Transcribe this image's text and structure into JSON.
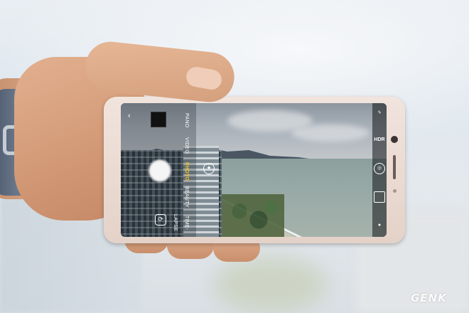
{
  "camera_ui": {
    "back_icon": "chevron-left-icon",
    "modes": [
      "PANO",
      "VIDEO",
      "PHOTO",
      "BEAUTY",
      "TIME-LAPSE"
    ],
    "active_mode": "PHOTO",
    "right_bar": {
      "hdr_label": "HDR",
      "icons": [
        "flash-icon",
        "hdr-icon",
        "filter-icon",
        "grid-icon",
        "dot-icon"
      ]
    },
    "left_bar_icons": [
      "gallery-thumbnail",
      "shutter-button",
      "switch-camera-icon",
      "effect-icon"
    ]
  },
  "watermark": "GENK",
  "colors": {
    "active_mode": "#f5c518",
    "phone_body": "#ecdcd2",
    "sea": "#98aaa6"
  }
}
